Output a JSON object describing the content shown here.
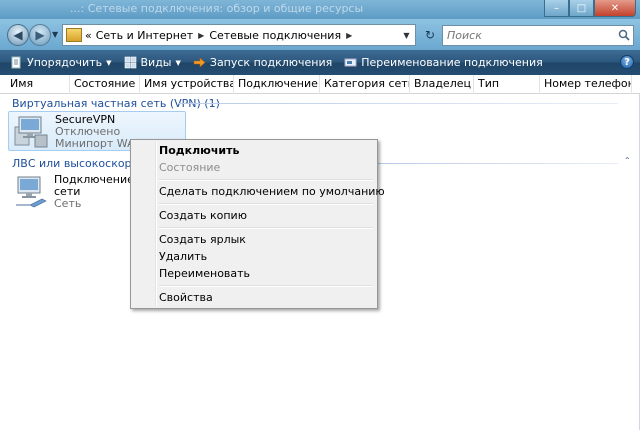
{
  "window": {
    "caption_faded": "...: Сетевые подключения: обзор и общие ресурсы",
    "min_glyph": "–",
    "max_glyph": "□",
    "close_glyph": "✕"
  },
  "nav": {
    "back_glyph": "◀",
    "fwd_glyph": "▶",
    "drop_glyph": "▼",
    "address": {
      "prefix": "«",
      "segments": [
        "Сеть и Интернет",
        "Сетевые подключения"
      ],
      "arrow_glyph": "▶",
      "drop_glyph": "▼"
    },
    "refresh_glyph": "↻",
    "search_placeholder": "Поиск"
  },
  "commandbar": {
    "items": [
      {
        "label": "Упорядочить",
        "icon": "organize-icon",
        "dropdown": true
      },
      {
        "label": "Виды",
        "icon": "views-icon",
        "dropdown": true
      },
      {
        "label": "Запуск подключения",
        "icon": "start-connection-icon",
        "dropdown": false
      },
      {
        "label": "Переименование подключения",
        "icon": "rename-connection-icon",
        "dropdown": false
      }
    ],
    "dropdown_glyph": "▼",
    "help_glyph": "?"
  },
  "columns": [
    "Имя",
    "Состояние",
    "Имя устройства",
    "Подключение",
    "Категория сети",
    "Владелец",
    "Тип",
    "Номер телефона..."
  ],
  "groups": [
    {
      "label": "Виртуальная частная сеть (VPN) (1)",
      "items": [
        {
          "name": "SecureVPN",
          "line2": "Отключено",
          "line3": "Минипорт WAN (...",
          "selected": true
        }
      ]
    },
    {
      "label": "ЛВС или высокоскоростн...",
      "items": [
        {
          "name": "Подключение по...",
          "line2": "сети",
          "line3": "Сеть",
          "selected": false
        }
      ]
    }
  ],
  "collapse_glyph": "⌃",
  "context_menu": {
    "items": [
      {
        "label": "Подключить",
        "style": "bold"
      },
      {
        "label": "Состояние",
        "style": "disabled"
      },
      {
        "separator": true
      },
      {
        "label": "Сделать подключением по умолчанию",
        "style": "normal"
      },
      {
        "separator": true
      },
      {
        "label": "Создать копию",
        "style": "normal"
      },
      {
        "separator": true
      },
      {
        "label": "Создать ярлык",
        "style": "normal"
      },
      {
        "label": "Удалить",
        "style": "normal"
      },
      {
        "label": "Переименовать",
        "style": "normal"
      },
      {
        "separator": true
      },
      {
        "label": "Свойства",
        "style": "normal"
      }
    ]
  },
  "colors": {
    "accent": "#1e4e9a",
    "commandbar": "#2c567c",
    "selection": "#d8ebfa"
  }
}
